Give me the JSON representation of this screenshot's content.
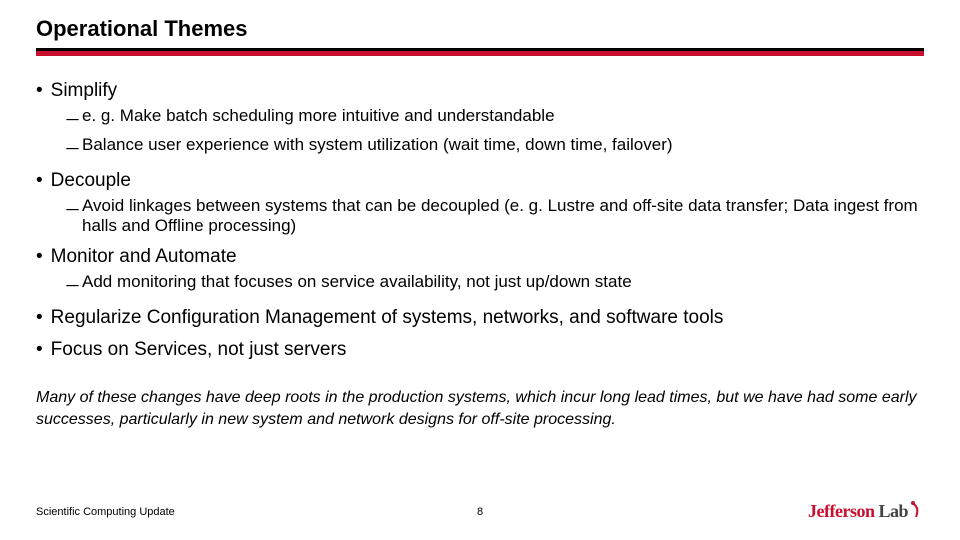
{
  "title": "Operational Themes",
  "bullets": {
    "b1": "Simplify",
    "b1s1": "e. g. Make batch scheduling more intuitive and understandable",
    "b1s2": "Balance user experience with system utilization (wait time, down time, failover)",
    "b2": "Decouple",
    "b2s1": "Avoid linkages between systems that can be decoupled (e. g. Lustre and off-site data transfer; Data ingest from halls and Offline processing)",
    "b3": "Monitor and Automate",
    "b3s1": "Add monitoring that focuses on service availability, not just up/down state",
    "b4": "Regularize Configuration Management of systems, networks, and software tools",
    "b5": "Focus on Services, not just servers"
  },
  "note": "Many of these changes have deep roots in the production systems, which incur long lead times, but we have had some early successes, particularly in new system and network designs for off-site processing.",
  "footer": {
    "left": "Scientific Computing Update",
    "page": "8",
    "logo_jef": "Jeffers̈on",
    "logo_lab": " Lab"
  },
  "dash": "－"
}
